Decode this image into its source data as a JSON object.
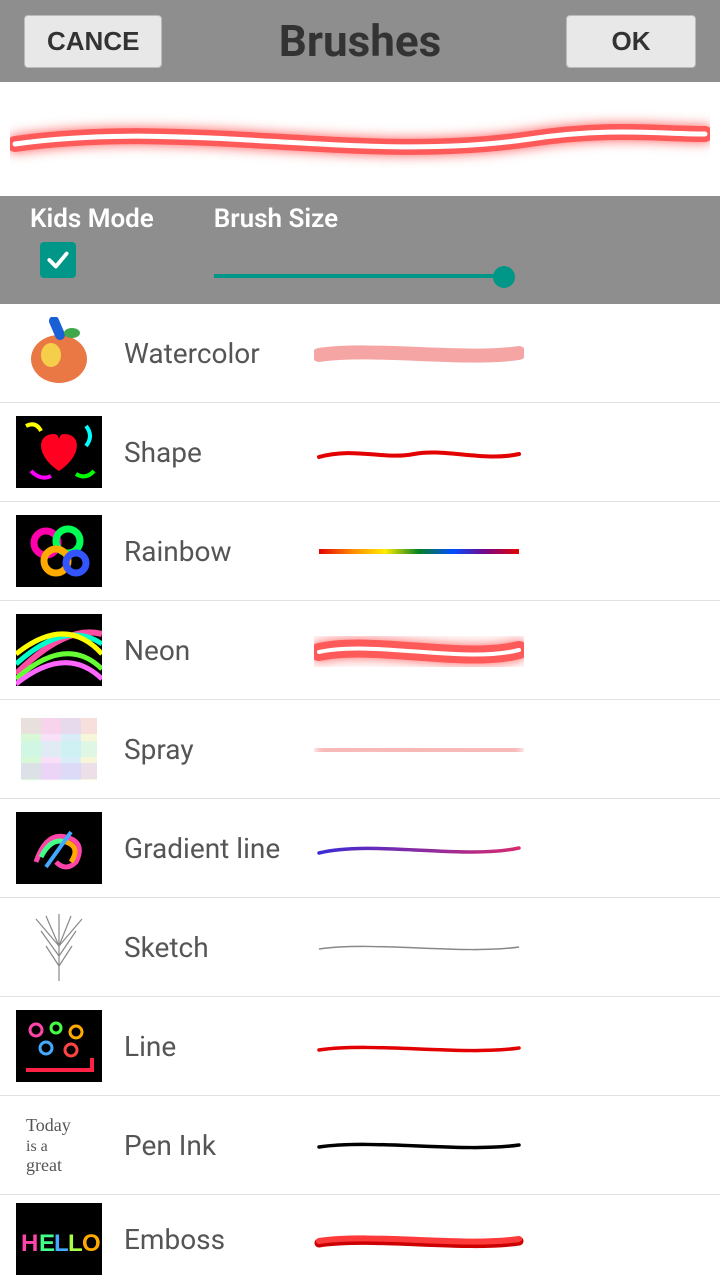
{
  "header": {
    "title": "Brushes",
    "cancel": "CANCE",
    "ok": "OK"
  },
  "controls": {
    "kids_mode_label": "Kids Mode",
    "kids_mode_checked": true,
    "brush_size_label": "Brush Size",
    "brush_size_value": 100
  },
  "brushes": [
    {
      "name": "Watercolor"
    },
    {
      "name": "Shape"
    },
    {
      "name": "Rainbow"
    },
    {
      "name": "Neon"
    },
    {
      "name": "Spray"
    },
    {
      "name": "Gradient line"
    },
    {
      "name": "Sketch"
    },
    {
      "name": "Line"
    },
    {
      "name": "Pen Ink"
    },
    {
      "name": "Emboss"
    }
  ]
}
